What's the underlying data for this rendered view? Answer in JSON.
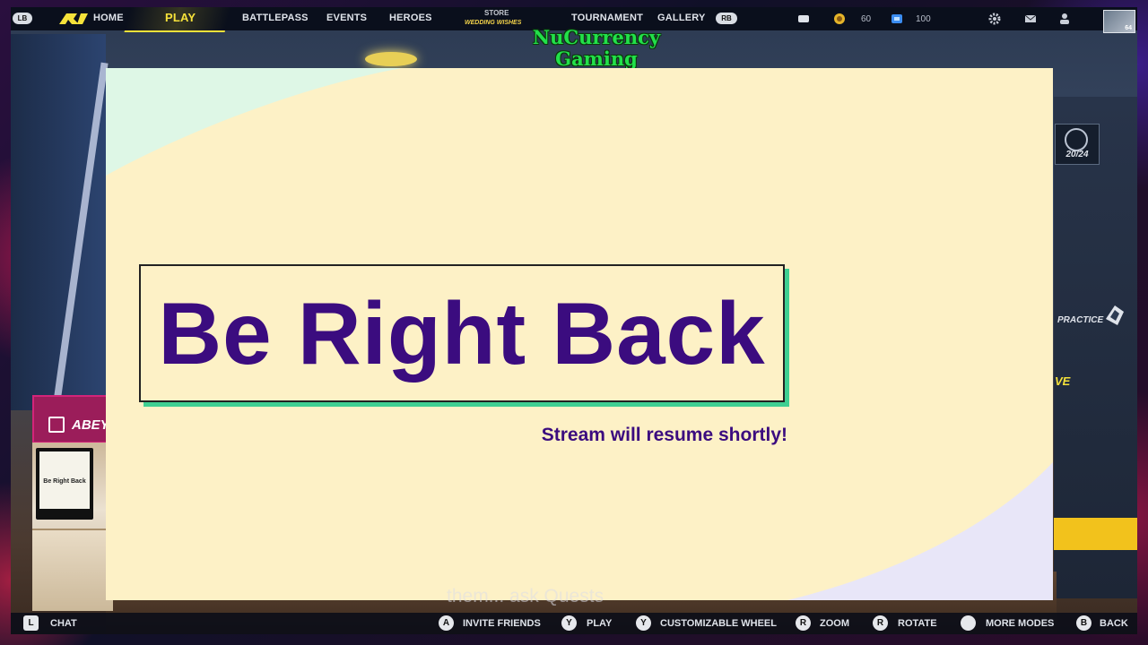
{
  "window": {
    "watermark_line1": "NuCurrency",
    "watermark_line2": "Gaming"
  },
  "topnav": {
    "lb": "LB",
    "rb": "RB",
    "items": [
      {
        "label": "HOME",
        "active": false
      },
      {
        "label": "PLAY",
        "active": true
      },
      {
        "label": "BATTLEPASS",
        "active": false
      },
      {
        "label": "EVENTS",
        "active": false
      },
      {
        "label": "HEROES",
        "active": false
      },
      {
        "label": "TOURNAMENT",
        "active": false
      },
      {
        "label": "GALLERY",
        "active": false
      }
    ],
    "store_label": "STORE",
    "store_promo": "WEDDING WISHES",
    "currency_gold": "60",
    "currency_blue": "100",
    "level_badge": "64"
  },
  "hud": {
    "trophy_progress": "20/24",
    "practice_label": "PRACTICE",
    "mode_fragment": "VE"
  },
  "webcam": {
    "channel_name": "ABEY",
    "monitor_text": "Be Right Back"
  },
  "brb": {
    "title": "Be Right Back",
    "subtitle": "Stream will resume shortly!"
  },
  "game_caption": "them... ask Quests",
  "bottombar": {
    "chat": {
      "button": "L",
      "label": "CHAT"
    },
    "actions": [
      {
        "button": "A",
        "label": "INVITE FRIENDS"
      },
      {
        "button": "Y",
        "label": "PLAY"
      },
      {
        "button": "Y",
        "label": "CUSTOMIZABLE WHEEL"
      },
      {
        "button": "R",
        "label": "ZOOM"
      },
      {
        "button": "R",
        "label": "ROTATE"
      },
      {
        "button": "",
        "label": "MORE MODES"
      },
      {
        "button": "B",
        "label": "BACK"
      }
    ]
  },
  "colors": {
    "brb_background": "#fdf1c6",
    "brb_text": "#3b0c7f",
    "brb_accent": "#3fcf92",
    "nav_active": "#f6e23a",
    "logo_green": "#22e04a"
  }
}
